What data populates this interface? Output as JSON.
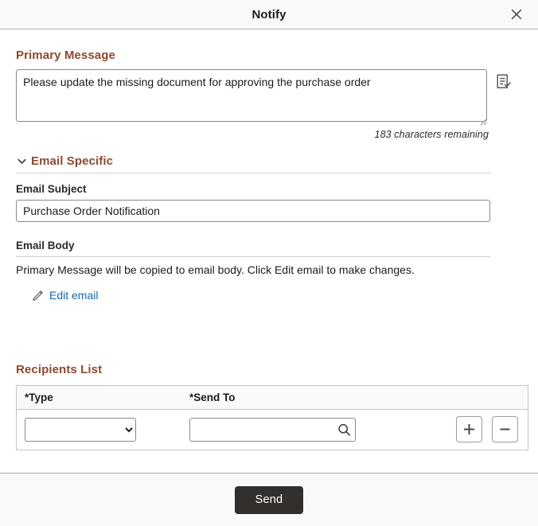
{
  "dialog": {
    "title": "Notify",
    "close_icon": "close-icon"
  },
  "primary_message": {
    "section_title": "Primary Message",
    "value": "Please update the missing document for approving the purchase order",
    "placeholder": "",
    "chars_remaining": "183 characters remaining",
    "spellcheck_icon": "spellcheck-document-icon"
  },
  "email_specific": {
    "section_title": "Email Specific",
    "expanded": true,
    "collapse_icon": "chevron-down-icon",
    "subject": {
      "label": "Email Subject",
      "value": "Purchase Order Notification",
      "placeholder": ""
    },
    "body": {
      "label": "Email Body",
      "note": "Primary Message will be copied to email body. Click Edit email to make changes.",
      "edit_link": "Edit email",
      "edit_icon": "pencil-icon"
    }
  },
  "recipients": {
    "section_title": "Recipients List",
    "columns": [
      {
        "label": "Type",
        "required_marker": "*"
      },
      {
        "label": "Send To",
        "required_marker": "*"
      }
    ],
    "rows": [
      {
        "type_value": "",
        "type_options": [
          ""
        ],
        "send_to_value": "",
        "send_to_placeholder": "",
        "lookup_icon": "search-icon",
        "add_icon": "plus-icon",
        "remove_icon": "minus-icon"
      }
    ]
  },
  "footer": {
    "send_label": "Send"
  },
  "colors": {
    "section_heading": "#8c4a2f",
    "link": "#1668b3",
    "send_button_bg": "#332f2c",
    "header_bg": "#faf9f7",
    "border": "#b3a9a0"
  }
}
